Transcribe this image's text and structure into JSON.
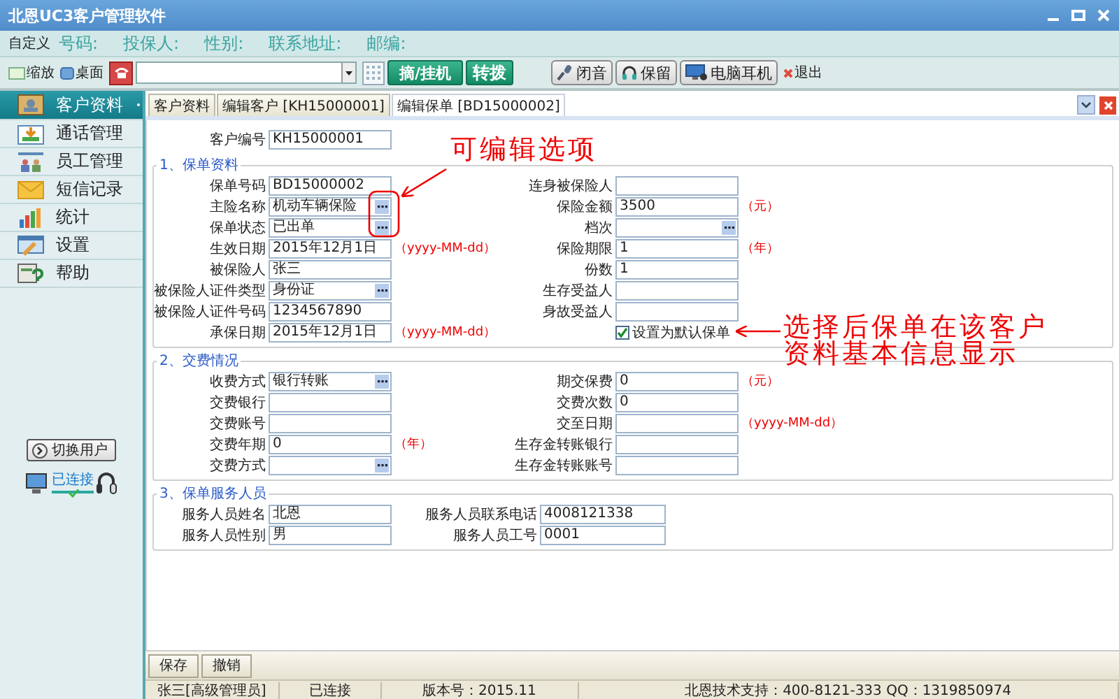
{
  "window": {
    "title": "北恩UC3客户管理软件"
  },
  "info_bar": {
    "customize": "自定义",
    "fields": [
      "号码:",
      "投保人:",
      "性别:",
      "联系地址:",
      "邮编:"
    ]
  },
  "toolbar": {
    "zoom": "缩放",
    "desktop": "桌面",
    "answer_button": "摘/挂机",
    "transfer_button": "转拨",
    "actions": [
      "闭音",
      "保留",
      "电脑耳机"
    ],
    "exit": "退出"
  },
  "sidebar": {
    "items": [
      {
        "label": "客户资料",
        "selected": true
      },
      {
        "label": "通话管理",
        "selected": false
      },
      {
        "label": "员工管理",
        "selected": false
      },
      {
        "label": "短信记录",
        "selected": false
      },
      {
        "label": "统计",
        "selected": false
      },
      {
        "label": "设置",
        "selected": false
      },
      {
        "label": "帮助",
        "selected": false
      }
    ],
    "switch_user": "切换用户",
    "connection": "已连接"
  },
  "tabs": [
    {
      "label": "客户资料",
      "selected": false
    },
    {
      "label": "编辑客户 [KH15000001]",
      "selected": false
    },
    {
      "label": "编辑保单 [BD15000002]",
      "selected": true
    }
  ],
  "customer_no": {
    "label": "客户编号",
    "value": "KH15000001"
  },
  "sections": [
    {
      "title": "1、保单资料",
      "rows": [
        {
          "left": {
            "kind": "text",
            "label": "保单号码",
            "value": "BD15000002"
          },
          "right": {
            "kind": "text",
            "label": "连身被保险人"
          }
        },
        {
          "left": {
            "kind": "picker",
            "label": "主险名称",
            "value": "机动车辆保险"
          },
          "right": {
            "kind": "text",
            "label": "保险金额",
            "value": "3500",
            "unit": "（元）"
          }
        },
        {
          "left": {
            "kind": "picker",
            "label": "保单状态",
            "value": "已出单"
          },
          "right": {
            "kind": "picker",
            "label": "档次"
          }
        },
        {
          "left": {
            "kind": "text",
            "label": "生效日期",
            "value": "2015年12月1日",
            "unit": "（yyyy-MM-dd）"
          },
          "right": {
            "kind": "text",
            "label": "保险期限",
            "value": "1",
            "unit": "（年）"
          }
        },
        {
          "left": {
            "kind": "text",
            "label": "被保险人",
            "value": "张三"
          },
          "right": {
            "kind": "text",
            "label": "份数",
            "value": "1"
          }
        },
        {
          "left": {
            "kind": "picker",
            "label": "被保险人证件类型",
            "value": "身份证"
          },
          "right": {
            "kind": "text",
            "label": "生存受益人"
          }
        },
        {
          "left": {
            "kind": "text",
            "label": "被保险人证件号码",
            "value": "1234567890"
          },
          "right": {
            "kind": "text",
            "label": "身故受益人"
          }
        },
        {
          "left": {
            "kind": "text",
            "label": "承保日期",
            "value": "2015年12月1日",
            "unit": "（yyyy-MM-dd）"
          },
          "right": {
            "kind": "checkbox",
            "label": "设置为默认保单",
            "checked": true
          }
        }
      ]
    },
    {
      "title": "2、交费情况",
      "rows": [
        {
          "left": {
            "kind": "picker",
            "label": "收费方式",
            "value": "银行转账"
          },
          "right": {
            "kind": "text",
            "label": "期交保费",
            "value": "0",
            "unit": "（元）"
          }
        },
        {
          "left": {
            "kind": "text",
            "label": "交费银行"
          },
          "right": {
            "kind": "text",
            "label": "交费次数",
            "value": "0"
          }
        },
        {
          "left": {
            "kind": "text",
            "label": "交费账号"
          },
          "right": {
            "kind": "text",
            "label": "交至日期",
            "unit": "（yyyy-MM-dd）"
          }
        },
        {
          "left": {
            "kind": "text",
            "label": "交费年期",
            "value": "0",
            "unit": "（年）"
          },
          "right": {
            "kind": "text",
            "label": "生存金转账银行"
          }
        },
        {
          "left": {
            "kind": "picker",
            "label": "交费方式"
          },
          "right": {
            "kind": "text",
            "label": "生存金转账账号"
          }
        }
      ]
    },
    {
      "title": "3、保单服务人员",
      "rows": [
        {
          "left": {
            "kind": "text",
            "label": "服务人员姓名",
            "value": "北恩"
          },
          "right": {
            "kind": "text",
            "label": "服务人员联系电话",
            "value": "4008121338"
          }
        },
        {
          "left": {
            "kind": "text",
            "label": "服务人员性别",
            "value": "男"
          },
          "right": {
            "kind": "text",
            "label": "服务人员工号",
            "value": "0001"
          }
        }
      ]
    }
  ],
  "annotations": [
    {
      "text": "可编辑选项"
    },
    {
      "text": "选择后保单在该客户资料基本信息显示"
    }
  ],
  "footer_buttons": [
    "保存",
    "撤销"
  ],
  "status_bar": [
    "张三[高级管理员]",
    "已连接",
    "版本号：2015.11",
    "北恩技术支持：400-8121-333 QQ：1319850974"
  ]
}
